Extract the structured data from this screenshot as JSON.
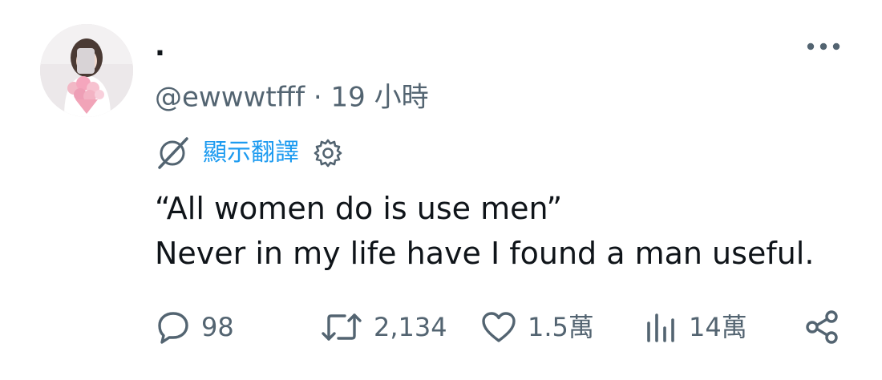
{
  "tweet": {
    "display_name": ".",
    "handle": "@ewwwtfff",
    "separator": "·",
    "time": "19 小時",
    "translate_label": "顯示翻譯",
    "lines": [
      "“All women do is use men”",
      "Never in my life have I found a man useful."
    ],
    "stats": {
      "replies": "98",
      "retweets": "2,134",
      "likes": "1.5萬",
      "views": "14萬"
    }
  },
  "icons": {
    "avatar": "avatar-photo",
    "more": "more-dots-icon",
    "translate": "globe-slash-icon",
    "settings": "gear-icon",
    "reply": "reply-bubble-icon",
    "retweet": "retweet-icon",
    "like": "heart-icon",
    "views": "views-bars-icon",
    "share": "share-icon"
  },
  "colors": {
    "text": "#0f1419",
    "muted": "#536471",
    "accent": "#1d9bf0",
    "background": "#ffffff"
  }
}
